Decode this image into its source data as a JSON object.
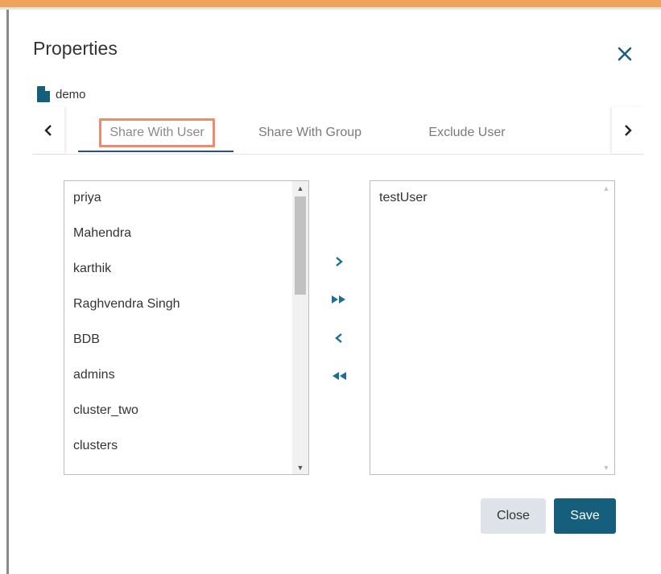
{
  "dialog": {
    "title": "Properties",
    "close_icon": "close-icon"
  },
  "file": {
    "icon": "file-icon",
    "name": "demo"
  },
  "tabs": {
    "prev_icon": "chevron-left-icon",
    "next_icon": "chevron-right-icon",
    "items": [
      {
        "label": "Share With User",
        "active": true
      },
      {
        "label": "Share With Group",
        "active": false
      },
      {
        "label": "Exclude User",
        "active": false
      }
    ]
  },
  "available_users": [
    "priya",
    "Mahendra",
    "karthik",
    "Raghvendra Singh",
    "BDB",
    "admins",
    "cluster_two",
    "clusters"
  ],
  "selected_users": [
    "testUser"
  ],
  "move_controls": [
    "move-right-icon",
    "move-all-right-icon",
    "move-left-icon",
    "move-all-left-icon"
  ],
  "footer": {
    "close_label": "Close",
    "save_label": "Save"
  },
  "colors": {
    "accent": "#155f7d",
    "highlight": "#ef8a6a",
    "tab_underline": "#2c4f94",
    "top_bar": "#f0a35a"
  }
}
